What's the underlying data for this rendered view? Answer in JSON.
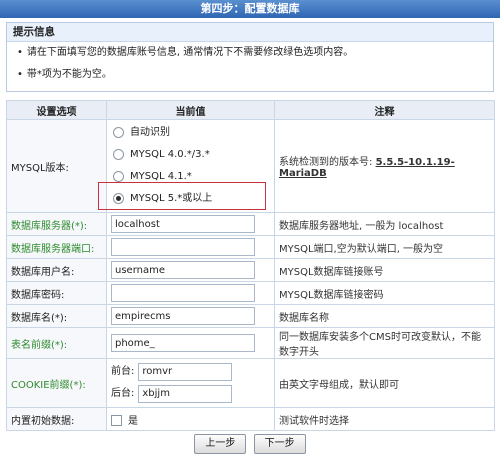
{
  "header": {
    "title": "第四步：配置数据库"
  },
  "notice": {
    "title": "提示信息",
    "lines": [
      "请在下面填写您的数据库账号信息, 通常情况下不需要修改绿色选项内容。",
      "带*项为不能为空。"
    ]
  },
  "table": {
    "headers": [
      "设置选项",
      "当前值",
      "注释"
    ],
    "mysql_version": {
      "label": "MYSQL版本:",
      "options": [
        "自动识别",
        "MYSQL 4.0.*/3.*",
        "MYSQL 4.1.*",
        "MYSQL 5.*或以上"
      ],
      "selected": "MYSQL 5.*或以上",
      "note_prefix": "系统检测到的版本号:",
      "note_version": "5.5.5-10.1.19-MariaDB"
    },
    "rows": [
      {
        "label": "数据库服务器(*):",
        "value": "localhost",
        "note": "数据库服务器地址, 一般为 localhost"
      },
      {
        "label": "数据库服务器端口:",
        "value": "",
        "note": "MYSQL端口,空为默认端口, 一般为空"
      },
      {
        "label": "数据库用户名:",
        "value": "username",
        "note": "MYSQL数据库链接账号"
      },
      {
        "label": "数据库密码:",
        "value": "",
        "note": "MYSQL数据库链接密码"
      },
      {
        "label": "数据库名(*):",
        "value": "empirecms",
        "note": "数据库名称"
      },
      {
        "label": "表名前缀(*):",
        "value": "phome_",
        "note": "同一数据库安装多个CMS时可改变默认，不能数字开头"
      }
    ],
    "cookie": {
      "label": "COOKIE前缀(*):",
      "front_label": "前台:",
      "front_value": "romvr",
      "back_label": "后台:",
      "back_value": "xbjjm",
      "note": "由英文字母组成，默认即可"
    },
    "init_data": {
      "label": "内置初始数据:",
      "option": "是",
      "note": "测试软件时选择"
    }
  },
  "buttons": {
    "prev": "上一步",
    "next": "下一步"
  }
}
